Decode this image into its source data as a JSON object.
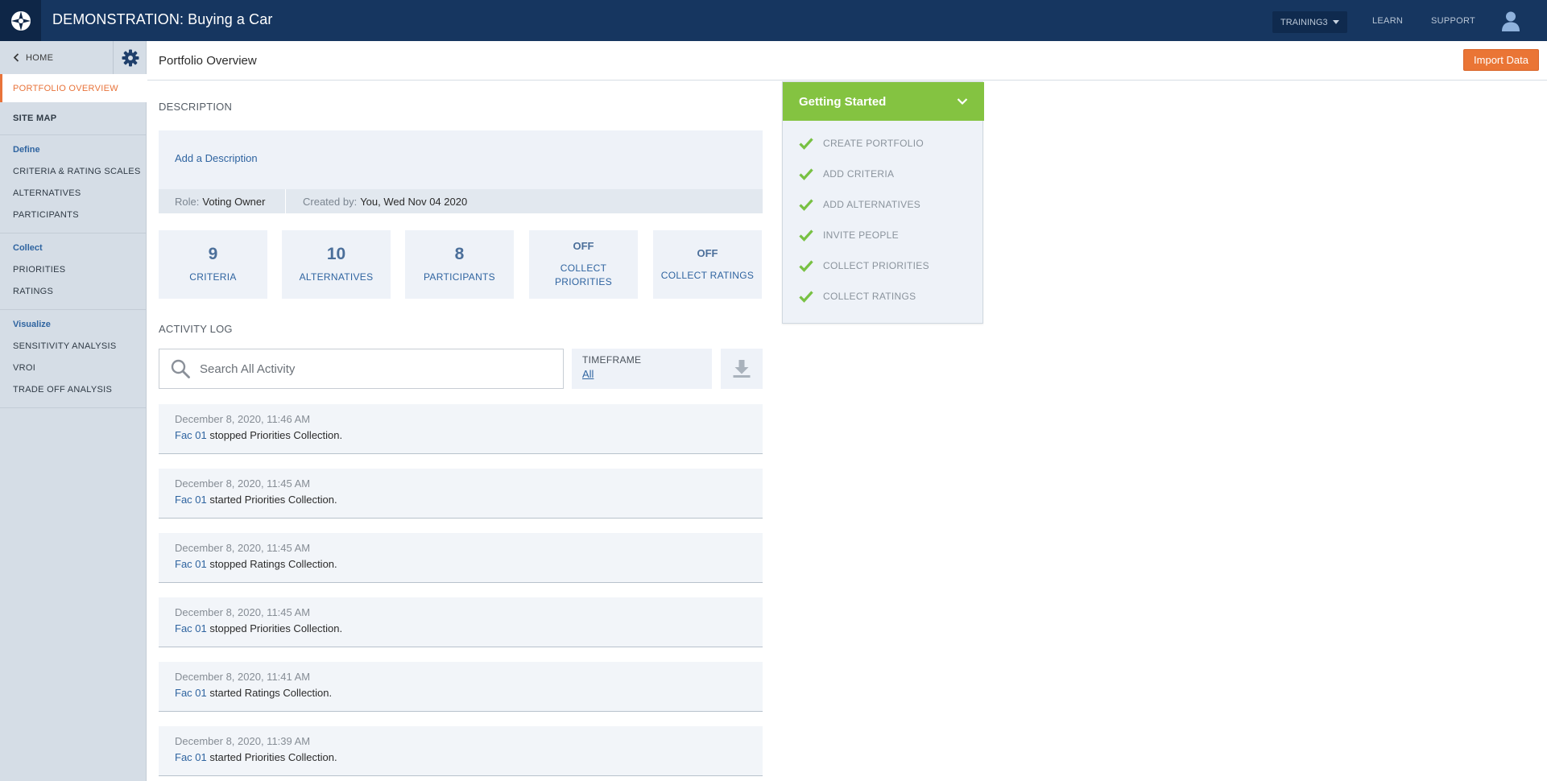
{
  "topbar": {
    "title": "DEMONSTRATION: Buying a Car",
    "tenant": "TRAINING3",
    "learn": "LEARN",
    "support": "SUPPORT"
  },
  "sidebar": {
    "home": "HOME",
    "active_item": "PORTFOLIO OVERVIEW",
    "site_map": "SITE MAP",
    "define": {
      "heading": "Define",
      "items": [
        "CRITERIA & RATING SCALES",
        "ALTERNATIVES",
        "PARTICIPANTS"
      ]
    },
    "collect": {
      "heading": "Collect",
      "items": [
        "PRIORITIES",
        "RATINGS"
      ]
    },
    "visualize": {
      "heading": "Visualize",
      "items": [
        "SENSITIVITY ANALYSIS",
        "VROI",
        "TRADE OFF ANALYSIS"
      ]
    }
  },
  "header": {
    "page_title": "Portfolio Overview",
    "import_button": "Import Data"
  },
  "description": {
    "label": "DESCRIPTION",
    "add_link": "Add a Description",
    "role_key": "Role:",
    "role_value": "Voting Owner",
    "created_key": "Created by:",
    "created_value": "You, Wed Nov 04 2020"
  },
  "stats": [
    {
      "value": "9",
      "label": "CRITERIA"
    },
    {
      "value": "10",
      "label": "ALTERNATIVES"
    },
    {
      "value": "8",
      "label": "PARTICIPANTS"
    },
    {
      "value": "OFF",
      "label_line1": "COLLECT",
      "label_line2": "PRIORITIES"
    },
    {
      "value": "OFF",
      "label": "COLLECT RATINGS"
    }
  ],
  "activity": {
    "label": "ACTIVITY LOG",
    "search_placeholder": "Search All Activity",
    "timeframe_label": "TIMEFRAME",
    "timeframe_value": "All",
    "entries": [
      {
        "date": "December 8, 2020, 11:46 AM",
        "actor": "Fac 01",
        "action": "stopped Priorities Collection."
      },
      {
        "date": "December 8, 2020, 11:45 AM",
        "actor": "Fac 01",
        "action": "started Priorities Collection."
      },
      {
        "date": "December 8, 2020, 11:45 AM",
        "actor": "Fac 01",
        "action": "stopped Ratings Collection."
      },
      {
        "date": "December 8, 2020, 11:45 AM",
        "actor": "Fac 01",
        "action": "stopped Priorities Collection."
      },
      {
        "date": "December 8, 2020, 11:41 AM",
        "actor": "Fac 01",
        "action": "started Ratings Collection."
      },
      {
        "date": "December 8, 2020, 11:39 AM",
        "actor": "Fac 01",
        "action": "started Priorities Collection."
      }
    ]
  },
  "getting_started": {
    "title": "Getting Started",
    "steps": [
      "CREATE PORTFOLIO",
      "ADD CRITERIA",
      "ADD ALTERNATIVES",
      "INVITE PEOPLE",
      "COLLECT PRIORITIES",
      "COLLECT RATINGS"
    ]
  },
  "colors": {
    "navy": "#163660",
    "accent_orange": "#ea7535",
    "success_green": "#84c341",
    "link_blue": "#2f64a0"
  }
}
